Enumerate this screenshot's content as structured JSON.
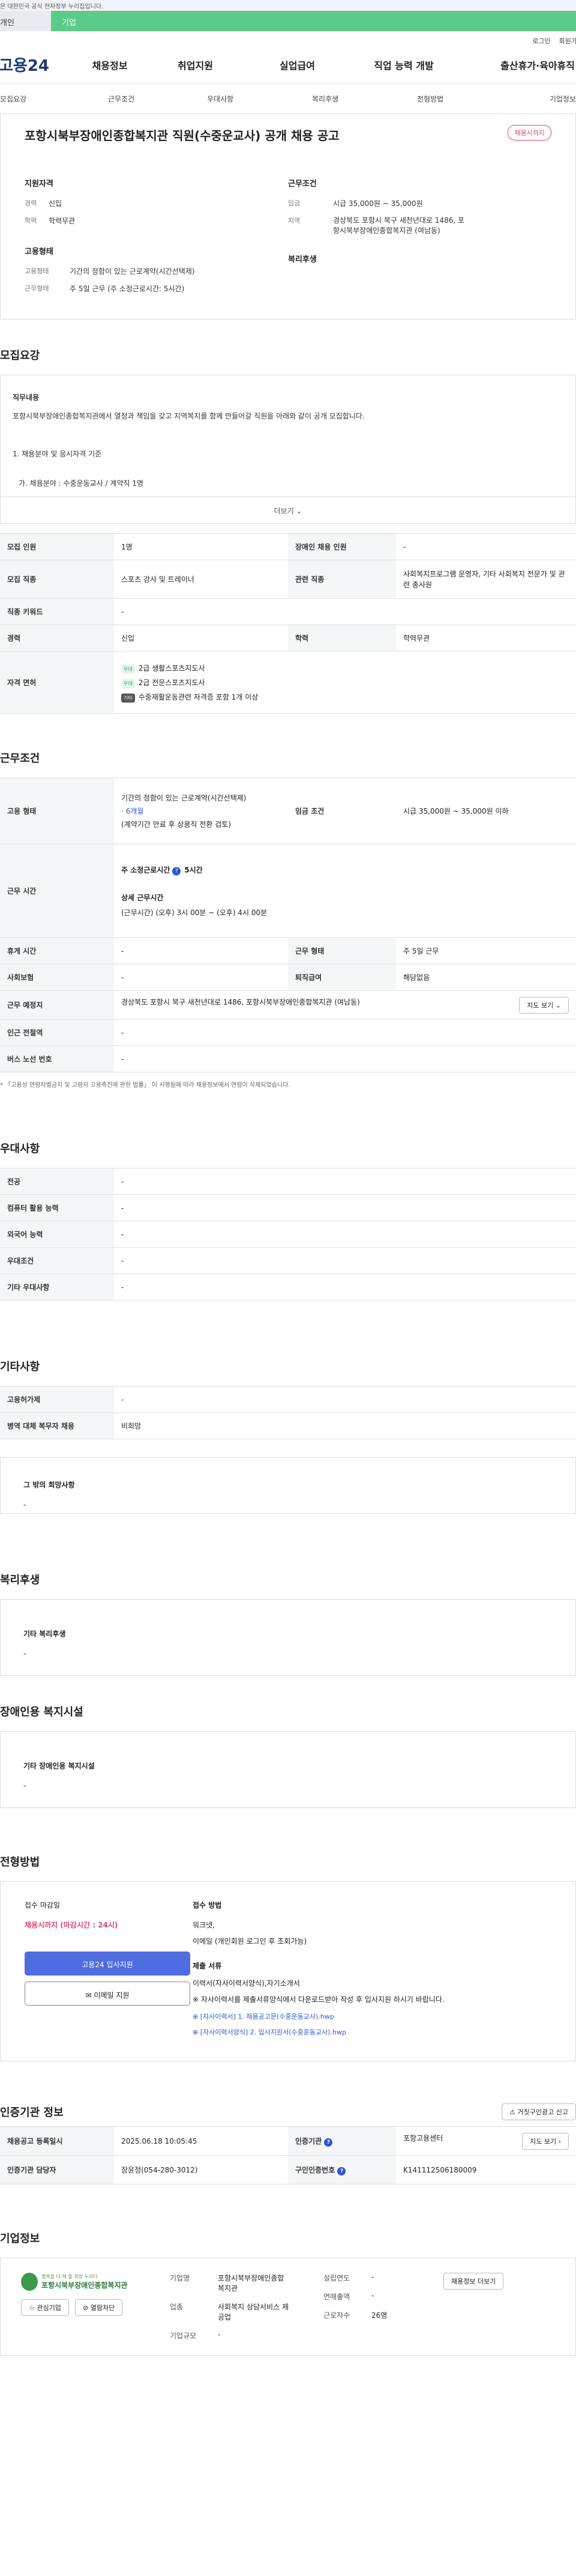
{
  "header": {
    "notice": "이 누리집은 대한민국 공식 전자정부 누리집입니다.",
    "tab_personal": "개인",
    "tab_company": "기업",
    "login": "로그인",
    "join": "회원가입",
    "logo": "고용24",
    "menu": [
      "채용정보",
      "취업지원",
      "실업급여",
      "직업 능력 개발",
      "출산휴가·육아휴직"
    ]
  },
  "subnav": [
    "모집요강",
    "근무조건",
    "우대사항",
    "복리후생",
    "전형방법",
    "기업정보"
  ],
  "job": {
    "title": "포항시북부장애인종합복지관 직원(수중운교사) 공개 채용 공고",
    "status": "채용시까지",
    "req_title": "지원자격",
    "career_k": "경력",
    "career_v": "신입",
    "edu_k": "학력",
    "edu_v": "학력무관",
    "emp_title": "고용형태",
    "emp_k": "고용형태",
    "emp_v": "기간의 정함이 있는 근로계약(시간선택제)",
    "work_k": "근무형태",
    "work_v": "주 5일 근무 (주 소정근로시간: 5시간)",
    "cond_title": "근무조건",
    "wage_k": "임금",
    "wage_v": "시급 35,000원 ~ 35,000원",
    "loc_k": "지역",
    "loc_v": "경상북도 포항시 북구 새천년대로 1486, 포항시북부장애인종합복지관 (여남동)",
    "welfare_title": "복리후생"
  },
  "recruit": {
    "title": "모집요강",
    "duty_title": "직무내용",
    "duty_text": "포항시북부장애인종합복지관에서 열정과 책임을 갖고 지역복지를 함께 만들어갈 직원을 아래와 같이 공개 모집합니다.",
    "item1": "1. 채용분야 및 응시자격 기준",
    "item2": "가. 채용분야 : 수중운동교사 / 계약직 1명",
    "more": "더보기",
    "rows": {
      "cnt_k": "모집 인원",
      "cnt_v": "1명",
      "dis_k": "장애인 채용 인원",
      "dis_v": "-",
      "job_k": "모집 직종",
      "job_v": "스포츠 강사 및 트레이너",
      "rel_k": "관련 직종",
      "rel_v": "사회복지프로그램 운영자, 기타 사회복지 전문가 및 관련 종사원",
      "kw_k": "직종 키워드",
      "kw_v": "-",
      "car_k": "경력",
      "car_v": "신입",
      "edu_k": "학력",
      "edu_v": "학력무관",
      "lic_k": "자격 면허",
      "lic1_tag": "우대",
      "lic1": "2급 생활스포츠지도사",
      "lic2_tag": "우대",
      "lic2": "2급 전문스포츠지도사",
      "lic3_tag": "기타",
      "lic3": "수중재활운동관련 자격증 포함 1개 이상"
    }
  },
  "work": {
    "title": "근무조건",
    "emp_k": "고용 형태",
    "emp_v1": "기간의 정함이 있는 근로계약(시간선택제)",
    "emp_v2": "· 6개월",
    "emp_v3": "(계약기간 만료 후 상용직 전환 검토)",
    "wage_k": "임금 조건",
    "wage_v": "시급 35,000원 ~ 35,000원 이하",
    "time_k": "근무 시간",
    "time_v1": "주 소정근로시간",
    "time_v2": "5시간",
    "time_v3": "상세 근무시간",
    "time_v4": "(근무시간) (오후) 3시 00분 ~ (오후) 4시 00분",
    "rest_k": "휴게 시간",
    "rest_v": "-",
    "type_k": "근무 형태",
    "type_v": "주 5일 근무",
    "ins_k": "사회보험",
    "ins_v": "-",
    "ret_k": "퇴직급여",
    "ret_v": "해당없음",
    "place_k": "근무 예정지",
    "place_v": "경상북도 포항시 북구 새천년대로 1486, 포항시북부장애인종합복지관 (여남동)",
    "map_btn": "지도 보기",
    "sub_k": "인근 전철역",
    "sub_v": "-",
    "bus_k": "버스 노선 번호",
    "bus_v": "-",
    "note": "* 「고용상 연령차별금지 및 고령자 고용촉진에 관한 법률」 이 시행됨에 따라 채용정보에서 연령이 삭제되었습니다."
  },
  "pref": {
    "title": "우대사항",
    "rows": [
      {
        "k": "전공",
        "v": "-"
      },
      {
        "k": "컴퓨터 활용 능력",
        "v": "-"
      },
      {
        "k": "외국어 능력",
        "v": "-"
      },
      {
        "k": "우대조건",
        "v": "-"
      },
      {
        "k": "기타 우대사항",
        "v": "-"
      }
    ]
  },
  "etc": {
    "title": "기타사항",
    "rows": [
      {
        "k": "고용허가제",
        "v": "-"
      },
      {
        "k": "병역 대체 복무자 채용",
        "v": "비희망"
      }
    ],
    "other_title": "그 밖의 희망사항",
    "other_v": "-"
  },
  "benefit": {
    "title": "복리후생",
    "sub": "기타 복리후생",
    "v": "-"
  },
  "disab": {
    "title": "장애인용 복지시설",
    "sub": "기타 장애인용 복지시설",
    "v": "-"
  },
  "process": {
    "title": "전형방법",
    "deadline_k": "접수 마감일",
    "deadline_v": "채용시까지 (마감시간 : 24시)",
    "apply_btn": "고용24 입사지원",
    "mail_btn": "이메일 지원",
    "method_k": "접수 방법",
    "method_v1": "워크넷,",
    "method_v2": "이메일 (개인회원 로그인 후 조회가능)",
    "docs_k": "제출 서류",
    "docs_v1": "이력서(자사이력서양식),자기소개서",
    "docs_v2": "※ 자사이력서를 제출서류양식에서 다운로드받아 작성 후 입사지원 하시기 바랍니다.",
    "file1": "[자사이력서] 1. 채용공고문(수중운동교사).hwp",
    "file2": "[자사이력서양식] 2. 입사지원서(수중운동교사).hwp"
  },
  "auth": {
    "title": "인증기관 정보",
    "report_btn": "거짓구인광고 신고",
    "reg_k": "채용공고 등록일시",
    "reg_v": "2025.06.18 10:05:45",
    "org_k": "인증기관",
    "org_v": "포항고용센터",
    "map_btn": "지도 보기",
    "mgr_k": "인증기관 담당자",
    "mgr_v": "장윤정(054-280-3012)",
    "no_k": "구인인증번호",
    "no_v": "K141112506180009"
  },
  "company": {
    "title": "기업정보",
    "logo_top": "행복을 더 해 줄 희망 누리다",
    "logo_name": "포항시북부장애인종합복지관",
    "fav_btn": "관심기업",
    "block_btn": "열람차단",
    "name_k": "기업명",
    "name_v": "포항시북부장애인종합복지관",
    "ind_k": "업종",
    "ind_v": "사회복지 상담서비스 제공업",
    "scale_k": "기업규모",
    "scale_v": "-",
    "year_k": "설립연도",
    "year_v": "-",
    "sales_k": "연매출액",
    "sales_v": "-",
    "emp_k": "근로자수",
    "emp_v": "26명",
    "info_btn": "채용정보 더보기"
  }
}
